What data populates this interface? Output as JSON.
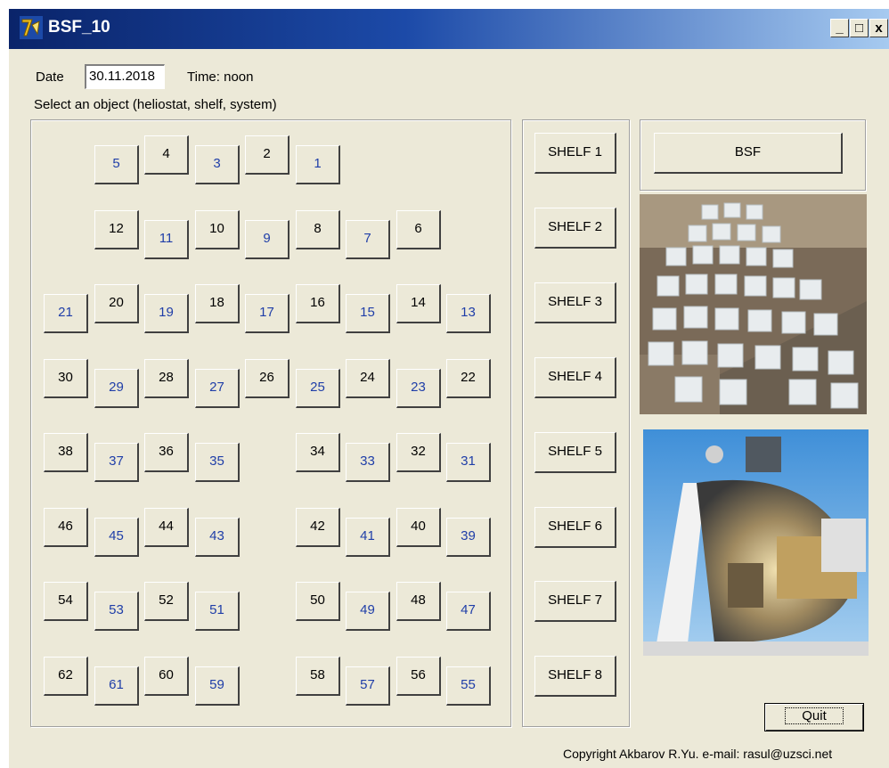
{
  "window": {
    "title": "BSF_10",
    "controls": [
      "_",
      "□",
      "x"
    ]
  },
  "date": {
    "label": "Date",
    "value": "30.11.2018"
  },
  "time_label": "Time: noon",
  "instruction": "Select an object (heliostat, shelf, system)",
  "heliostats": [
    {
      "n": "5",
      "c": 1,
      "r": 0
    },
    {
      "n": "4",
      "c": 2,
      "r": 0
    },
    {
      "n": "3",
      "c": 3,
      "r": 0
    },
    {
      "n": "2",
      "c": 4,
      "r": 0
    },
    {
      "n": "1",
      "c": 5,
      "r": 0
    },
    {
      "n": "12",
      "c": 1,
      "r": 1
    },
    {
      "n": "11",
      "c": 2,
      "r": 1
    },
    {
      "n": "10",
      "c": 3,
      "r": 1
    },
    {
      "n": "9",
      "c": 4,
      "r": 1
    },
    {
      "n": "8",
      "c": 5,
      "r": 1
    },
    {
      "n": "7",
      "c": 6,
      "r": 1
    },
    {
      "n": "6",
      "c": 7,
      "r": 1
    },
    {
      "n": "21",
      "c": 0,
      "r": 2
    },
    {
      "n": "20",
      "c": 1,
      "r": 2
    },
    {
      "n": "19",
      "c": 2,
      "r": 2
    },
    {
      "n": "18",
      "c": 3,
      "r": 2
    },
    {
      "n": "17",
      "c": 4,
      "r": 2
    },
    {
      "n": "16",
      "c": 5,
      "r": 2
    },
    {
      "n": "15",
      "c": 6,
      "r": 2
    },
    {
      "n": "14",
      "c": 7,
      "r": 2
    },
    {
      "n": "13",
      "c": 8,
      "r": 2
    },
    {
      "n": "30",
      "c": 0,
      "r": 3
    },
    {
      "n": "29",
      "c": 1,
      "r": 3
    },
    {
      "n": "28",
      "c": 2,
      "r": 3
    },
    {
      "n": "27",
      "c": 3,
      "r": 3
    },
    {
      "n": "26",
      "c": 4,
      "r": 3
    },
    {
      "n": "25",
      "c": 5,
      "r": 3
    },
    {
      "n": "24",
      "c": 6,
      "r": 3
    },
    {
      "n": "23",
      "c": 7,
      "r": 3
    },
    {
      "n": "22",
      "c": 8,
      "r": 3
    },
    {
      "n": "38",
      "c": 0,
      "r": 4
    },
    {
      "n": "37",
      "c": 1,
      "r": 4
    },
    {
      "n": "36",
      "c": 2,
      "r": 4
    },
    {
      "n": "35",
      "c": 3,
      "r": 4
    },
    {
      "n": "34",
      "c": 5,
      "r": 4
    },
    {
      "n": "33",
      "c": 6,
      "r": 4
    },
    {
      "n": "32",
      "c": 7,
      "r": 4
    },
    {
      "n": "31",
      "c": 8,
      "r": 4
    },
    {
      "n": "46",
      "c": 0,
      "r": 5
    },
    {
      "n": "45",
      "c": 1,
      "r": 5
    },
    {
      "n": "44",
      "c": 2,
      "r": 5
    },
    {
      "n": "43",
      "c": 3,
      "r": 5
    },
    {
      "n": "42",
      "c": 5,
      "r": 5
    },
    {
      "n": "41",
      "c": 6,
      "r": 5
    },
    {
      "n": "40",
      "c": 7,
      "r": 5
    },
    {
      "n": "39",
      "c": 8,
      "r": 5
    },
    {
      "n": "54",
      "c": 0,
      "r": 6
    },
    {
      "n": "53",
      "c": 1,
      "r": 6
    },
    {
      "n": "52",
      "c": 2,
      "r": 6
    },
    {
      "n": "51",
      "c": 3,
      "r": 6
    },
    {
      "n": "50",
      "c": 5,
      "r": 6
    },
    {
      "n": "49",
      "c": 6,
      "r": 6
    },
    {
      "n": "48",
      "c": 7,
      "r": 6
    },
    {
      "n": "47",
      "c": 8,
      "r": 6
    },
    {
      "n": "62",
      "c": 0,
      "r": 7
    },
    {
      "n": "61",
      "c": 1,
      "r": 7
    },
    {
      "n": "60",
      "c": 2,
      "r": 7
    },
    {
      "n": "59",
      "c": 3,
      "r": 7
    },
    {
      "n": "58",
      "c": 5,
      "r": 7
    },
    {
      "n": "57",
      "c": 6,
      "r": 7
    },
    {
      "n": "56",
      "c": 7,
      "r": 7
    },
    {
      "n": "55",
      "c": 8,
      "r": 7
    }
  ],
  "shelves": [
    "SHELF 1",
    "SHELF 2",
    "SHELF 3",
    "SHELF 4",
    "SHELF 5",
    "SHELF 6",
    "SHELF 7",
    "SHELF 8"
  ],
  "bsf_button": "BSF",
  "quit_button": "Quit",
  "copyright": "Copyright  Akbarov R.Yu. e-mail: rasul@uzsci.net",
  "colors": {
    "odd_label": "#1f3ea8",
    "even_label": "#000000",
    "face": "#ece9d8"
  }
}
